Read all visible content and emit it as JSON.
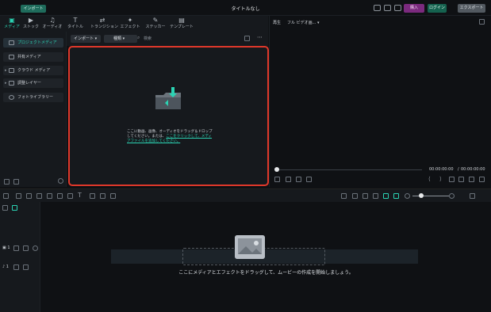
{
  "titlebar": {
    "import_label": "インポート",
    "title": "タイトルなし",
    "purchase_label": "購入",
    "login_label": "ログイン",
    "export_label": "エクスポート"
  },
  "toolbar": {
    "tabs": [
      {
        "label": "メディア",
        "icon": "media-icon"
      },
      {
        "label": "ストック",
        "icon": "stock-icon"
      },
      {
        "label": "オーディオ",
        "icon": "audio-icon"
      },
      {
        "label": "タイトル",
        "icon": "title-icon"
      },
      {
        "label": "トランジション",
        "icon": "transition-icon"
      },
      {
        "label": "エフェクト",
        "icon": "effect-icon"
      },
      {
        "label": "ステッカー",
        "icon": "sticker-icon"
      },
      {
        "label": "テンプレート",
        "icon": "template-icon"
      }
    ]
  },
  "sidebar": {
    "items": [
      {
        "label": "プロジェクトメディア"
      },
      {
        "label": "共有メディア"
      },
      {
        "label": "クラウド メディア"
      },
      {
        "label": "調整レイヤー"
      },
      {
        "label": "フォトライブラリー"
      }
    ]
  },
  "media": {
    "import_button": "インポート",
    "filter_label": "種類",
    "search_placeholder": "検索",
    "drop_text_1": "ここに動画、画像、オーディオをドラッグ＆ドロップしてください。または、",
    "drop_link": "ここをクリックして、メディアファイルを追加してください。"
  },
  "preview": {
    "label": "再生",
    "quality": "フル ビデオ画...",
    "current_time": "00:00:00:00",
    "separator": "/",
    "total_time": "00:00:00:00"
  },
  "timeline": {
    "message": "ここにメディアとエフェクトをドラッグして、ムービーの作成を開始しましょう。",
    "video_track": "1",
    "audio_track": "1"
  }
}
